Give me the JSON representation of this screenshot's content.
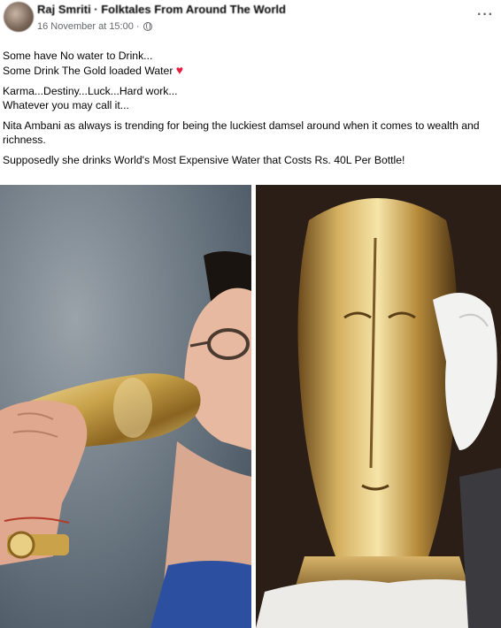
{
  "post": {
    "author": "Raj Smriti · Folktales From Around The World",
    "timestamp": "16 November at 15:00 ·",
    "privacy_icon": "globe-icon",
    "more_label": "···",
    "lines": {
      "l1": "Some have No water to Drink...",
      "l2": "Some Drink The Gold loaded Water",
      "heart": "♥",
      "l3": "Karma...Destiny...Luck...Hard work...",
      "l4": "Whatever you may call it...",
      "l5": "Nita Ambani as always is trending for being the luckiest damsel around when it comes to wealth and richness.",
      "l6": "Supposedly she drinks World's Most Expensive Water that Costs Rs. 40L Per Bottle!"
    }
  },
  "colors": {
    "text": "#050505",
    "meta": "#65676b",
    "heart": "#e41e3f",
    "gold": "#c9a24a"
  }
}
